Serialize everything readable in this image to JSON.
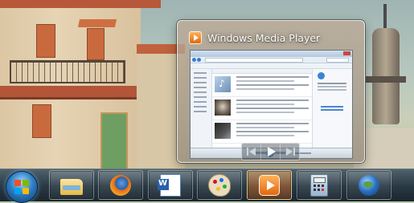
{
  "preview": {
    "title": "Windows Media Player",
    "app_icon": "windows-media-player-icon",
    "toolbar": [
      {
        "name": "previous-track-button",
        "icon": "previous-track-icon"
      },
      {
        "name": "play-button",
        "icon": "play-icon"
      },
      {
        "name": "next-track-button",
        "icon": "next-track-icon"
      }
    ]
  },
  "taskbar": {
    "start_button": {
      "icon": "windows-start-orb-icon"
    },
    "pinned": [
      {
        "name": "windows-explorer",
        "icon": "folder-library-icon"
      },
      {
        "name": "firefox",
        "icon": "firefox-icon"
      },
      {
        "name": "microsoft-word",
        "icon": "word-icon"
      },
      {
        "name": "paint",
        "icon": "paint-palette-icon"
      },
      {
        "name": "windows-media-player",
        "icon": "windows-media-player-icon",
        "active": true
      },
      {
        "name": "calculator",
        "icon": "calculator-icon"
      },
      {
        "name": "google-earth",
        "icon": "google-earth-icon"
      }
    ]
  },
  "colors": {
    "taskbar_active": "#e2670f",
    "wmp_accent": "#ffb25b"
  }
}
